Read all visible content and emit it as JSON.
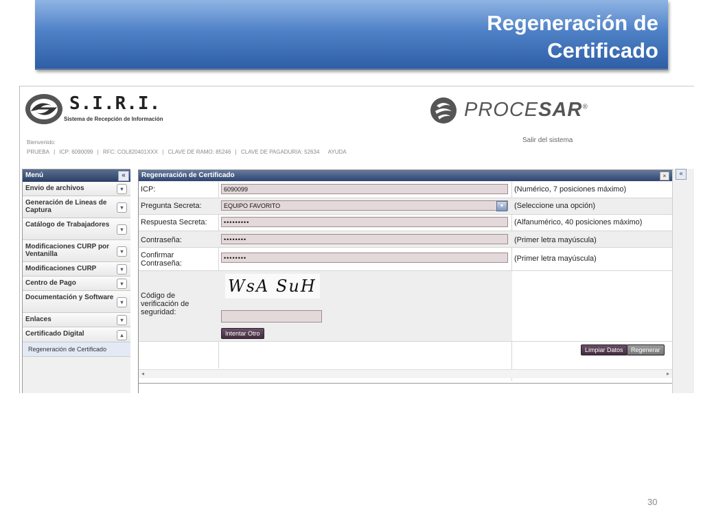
{
  "slide": {
    "title_line1": "Regeneración de",
    "title_line2": "Certificado",
    "page_number": "30"
  },
  "header": {
    "logo_name": "S.I.R.I.",
    "logo_subtitle": "Sistema de Recepción de Información",
    "partner_logo_prefix": "PROCE",
    "partner_logo_suffix": "SAR",
    "partner_logo_mark": "®",
    "welcome": "Bienvenido:",
    "info": [
      "PRUEBA",
      "|",
      "ICP: 6090099",
      "|",
      "RFC: COL820401XXX",
      "|",
      "CLAVE DE RAMO: 85246",
      "|",
      "CLAVE DE PAGADURIA: 52634",
      "AYUDA"
    ],
    "logout": "Salir del sistema"
  },
  "sidebar": {
    "title": "Menú",
    "collapse_glyph": "«",
    "items": [
      {
        "label": "Envio de archivos",
        "arrow": "▾"
      },
      {
        "label": "Generación de Lineas de Captura",
        "arrow": "▾"
      },
      {
        "label": "Catálogo de Trabajadores",
        "arrow": "▾"
      },
      {
        "label": "Modificaciones CURP por Ventanilla",
        "arrow": "▾"
      },
      {
        "label": "Modificaciones CURP",
        "arrow": "▾"
      },
      {
        "label": "Centro de Pago",
        "arrow": "▾"
      },
      {
        "label": "Documentación y Software",
        "arrow": "▾"
      },
      {
        "label": "Enlaces",
        "arrow": "▾"
      },
      {
        "label": "Certificado Digital",
        "arrow": "▴"
      }
    ],
    "subitem": "Regeneración de Certificado"
  },
  "panel": {
    "title": "Regeneración de Certificado",
    "close_glyph": "×",
    "right_collapse_glyph": "«",
    "fields": {
      "icp": {
        "label": "ICP:",
        "value": "6090099",
        "hint": "(Numérico, 7 posiciones máximo)"
      },
      "question": {
        "label": "Pregunta Secreta:",
        "value": "EQUIPO FAVORITO",
        "hint": "(Seleccione una opción)"
      },
      "answer": {
        "label": "Respuesta Secreta:",
        "value": "•••••••••",
        "hint": "(Alfanumérico, 40 posiciones máximo)"
      },
      "password": {
        "label": "Contraseña:",
        "value": "••••••••",
        "hint": "(Primer letra mayúscula)"
      },
      "confirm": {
        "label": "Confirmar Contraseña:",
        "value": "••••••••",
        "hint": "(Primer letra mayúscula)"
      },
      "captcha": {
        "label": "Código de verificación de seguridad:",
        "image_text": "WsA SuH",
        "value": ""
      }
    },
    "buttons": {
      "retry": "Intentar Otro",
      "clear": "Limpiar Datos",
      "regenerate": "Regenerar"
    },
    "scroll_left": "◂",
    "scroll_right": "▸"
  },
  "colors": {
    "banner": "#4f81c7",
    "header_bar": "#2e4470",
    "field_bg": "#e3d8da",
    "button_dark": "#412d3f"
  }
}
